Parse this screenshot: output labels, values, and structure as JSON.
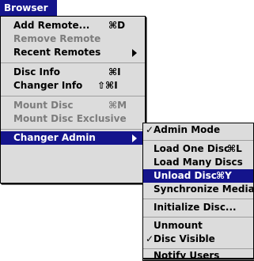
{
  "menubar": {
    "title": "Browser"
  },
  "main_menu": {
    "add_remote": {
      "label": "Add Remote...",
      "shortcut": "⌘D"
    },
    "remove_remote": {
      "label": "Remove Remote"
    },
    "recent_remotes": {
      "label": "Recent Remotes"
    },
    "disc_info": {
      "label": "Disc Info",
      "shortcut": "⌘I"
    },
    "changer_info": {
      "label": "Changer Info",
      "shortcut": "⇧⌘I"
    },
    "mount_disc": {
      "label": "Mount Disc",
      "shortcut": "⌘M"
    },
    "mount_disc_exclusive": {
      "label": "Mount Disc Exclusive"
    },
    "changer_admin": {
      "label": "Changer Admin"
    }
  },
  "submenu": {
    "admin_mode": {
      "label": "Admin Mode",
      "checked": "✓"
    },
    "load_one_disc": {
      "label": "Load One Disc",
      "shortcut": "⌘L"
    },
    "load_many_discs": {
      "label": "Load Many Discs"
    },
    "unload_disc": {
      "label": "Unload Disc",
      "shortcut": "⌘Y"
    },
    "synchronize_media": {
      "label": "Synchronize Media"
    },
    "initialize_disc": {
      "label": "Initialize Disc..."
    },
    "unmount": {
      "label": "Unmount"
    },
    "disc_visible": {
      "label": "Disc Visible",
      "checked": "✓"
    },
    "notify_users": {
      "label": "Notify Users"
    }
  },
  "colors": {
    "highlight": "#14148c",
    "menu_bg": "#dcdcdc",
    "disabled": "#7c7c7c"
  }
}
